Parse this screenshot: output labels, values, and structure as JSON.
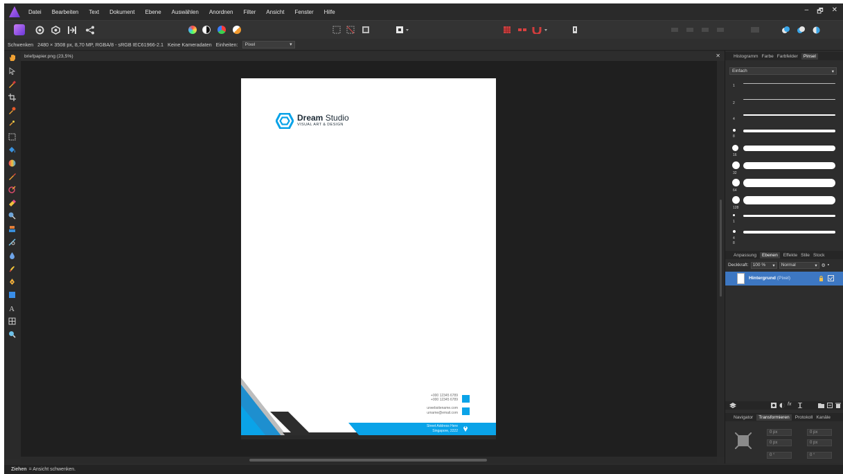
{
  "menu": [
    "Datei",
    "Bearbeiten",
    "Text",
    "Dokument",
    "Ebene",
    "Auswählen",
    "Anordnen",
    "Filter",
    "Ansicht",
    "Fenster",
    "Hilfe"
  ],
  "window_controls": [
    "–",
    "🗗",
    "✕"
  ],
  "context": {
    "tool": "Schwenken",
    "doc_info": "2480 × 3508 px, 8,70 MP, RGBA/8 - sRGB IEC61966-2.1",
    "camera": "Keine Kameradaten",
    "units_label": "Einheiten:",
    "units_value": "Pixel"
  },
  "document": {
    "tab_title": "briefpapier.png (23,5%)",
    "close": "✕"
  },
  "letterhead": {
    "brand_bold": "Dream",
    "brand_light": " Studio",
    "tagline": "VISUAL ART & DESIGN",
    "phone1": "+000 12345 6789",
    "phone2": "+000 12345 6789",
    "website": "urwebsitename.com",
    "email": "urname@email.com",
    "address1": "Street Address Here",
    "address2": "Singapore, 2222"
  },
  "status": {
    "bold": "Ziehen",
    "text": "= Ansicht schwenken."
  },
  "panel_top": {
    "tabs": [
      "Histogramm",
      "Farbe",
      "Farbfelder",
      "Pinsel"
    ],
    "active": "Pinsel",
    "category": "Einfach",
    "brush_sizes": [
      "1",
      "2",
      "4",
      "8",
      "16",
      "32",
      "64",
      "128",
      "1",
      "4",
      "8"
    ]
  },
  "panel_layers": {
    "tabs": [
      "Anpassung",
      "Ebenen",
      "Effekte",
      "Stile",
      "Stock"
    ],
    "active": "Ebenen",
    "opacity_label": "Deckkraft:",
    "opacity_value": "100 %",
    "blend_mode": "Normal",
    "layer_name": "Hintergrund",
    "layer_type": " (Pixel)"
  },
  "panel_bottom": {
    "tabs": [
      "Navigator",
      "Transformieren",
      "Protokoll",
      "Kanäle"
    ],
    "active": "Transformieren",
    "fields": [
      "0 px",
      "0 px",
      "0 px",
      "0 px",
      "0 °",
      "0 °"
    ]
  },
  "colors": {
    "accent_blue": "#0aa3e8",
    "layer_selected": "#3d77c2",
    "canvas_bg": "#1f1f1f"
  }
}
